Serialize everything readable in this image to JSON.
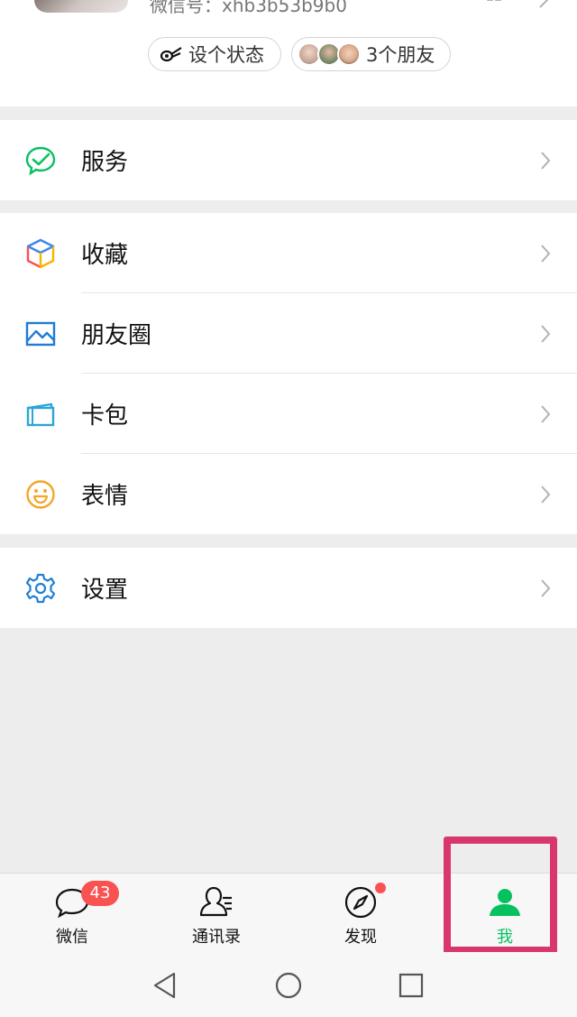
{
  "profile": {
    "wechat_id": "微信号：xhb3b53b9b0",
    "status_chip": "设个状态",
    "friends_chip": "3个朋友"
  },
  "menu": {
    "service": "服务",
    "favorites": "收藏",
    "moments": "朋友圈",
    "cards": "卡包",
    "stickers": "表情",
    "settings": "设置"
  },
  "tabs": [
    {
      "label": "微信",
      "badge": "43",
      "icon": "chat-bubble-icon"
    },
    {
      "label": "通讯录",
      "icon": "contacts-icon"
    },
    {
      "label": "发现",
      "icon": "compass-icon",
      "dot": true
    },
    {
      "label": "我",
      "icon": "person-icon",
      "active": true
    }
  ],
  "colors": {
    "accent": "#07c160",
    "badge": "#fa5151",
    "highlight": "#d8366f"
  }
}
